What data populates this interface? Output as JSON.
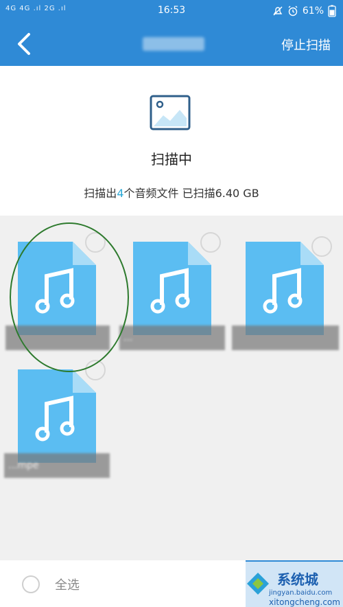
{
  "status_bar": {
    "left": "4G 4G .ıl 2G .ıl",
    "time": "16:53",
    "battery": "61%",
    "icons": [
      "mute-icon",
      "alarm-icon"
    ]
  },
  "app_bar": {
    "back_icon": "chevron-left-icon",
    "stop_label": "停止扫描"
  },
  "scan": {
    "title": "扫描中",
    "info_prefix": "扫描出",
    "count": "4",
    "info_suffix": "个音频文件 已扫描6.40 GB"
  },
  "files": [
    {
      "icon": "music-file-icon",
      "name": ""
    },
    {
      "icon": "music-file-icon",
      "name": "..."
    },
    {
      "icon": "music-file-icon",
      "name": ""
    },
    {
      "icon": "music-file-icon",
      "name": "...mpe"
    }
  ],
  "bottom": {
    "select_all": "全选"
  },
  "watermark": {
    "line1": "jingyan.baidu.com",
    "line2": "xitongcheng.com",
    "big": "系统城"
  },
  "colors": {
    "primary": "#2f8ad6",
    "file_icon": "#5bbdf2",
    "count_accent": "#2aa7d6",
    "annotation": "#2d7a2d"
  }
}
